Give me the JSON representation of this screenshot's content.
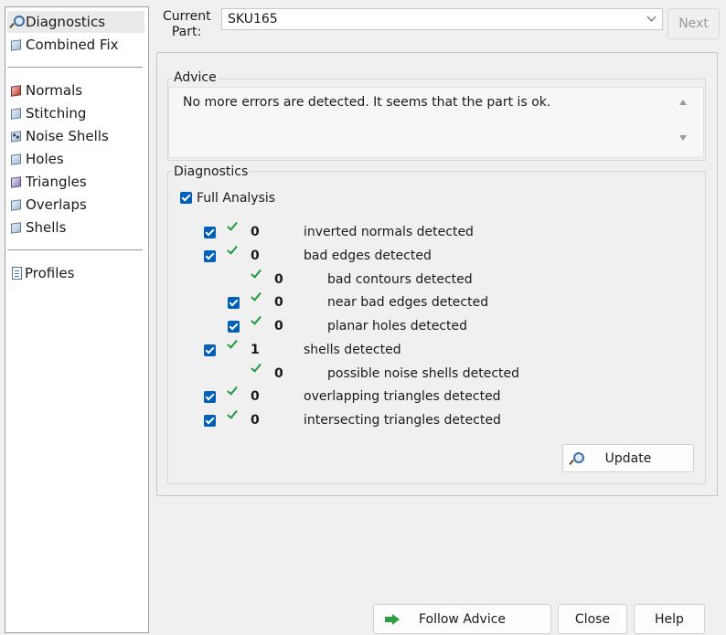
{
  "sidebar": {
    "items": [
      {
        "label": "Diagnostics",
        "icon": "search-icon"
      },
      {
        "label": "Combined Fix",
        "icon": "cube-icon"
      },
      {
        "label": "Normals",
        "icon": "cube-red-icon"
      },
      {
        "label": "Stitching",
        "icon": "cube-icon"
      },
      {
        "label": "Noise Shells",
        "icon": "cube-dots-icon"
      },
      {
        "label": "Holes",
        "icon": "cube-icon"
      },
      {
        "label": "Triangles",
        "icon": "cube-violet-icon"
      },
      {
        "label": "Overlaps",
        "icon": "cube-icon"
      },
      {
        "label": "Shells",
        "icon": "cube-icon"
      },
      {
        "label": "Profiles",
        "icon": "document-icon"
      }
    ]
  },
  "header": {
    "current_part_label": "Current Part:",
    "part_value": "SKU165",
    "next_label": "Next"
  },
  "advice": {
    "title": "Advice",
    "text": "No more errors are detected. It seems that the part is ok."
  },
  "diagnostics": {
    "title": "Diagnostics",
    "full_analysis_label": "Full Analysis",
    "rows": [
      {
        "count": "0",
        "label": "inverted normals detected",
        "checkbox": true
      },
      {
        "count": "0",
        "label": "bad edges detected",
        "checkbox": true
      },
      {
        "count": "0",
        "label": "bad contours detected",
        "checkbox": false
      },
      {
        "count": "0",
        "label": "near bad edges detected",
        "checkbox": true
      },
      {
        "count": "0",
        "label": "planar holes detected",
        "checkbox": true
      },
      {
        "count": "1",
        "label": "shells detected",
        "checkbox": true
      },
      {
        "count": "0",
        "label": "possible noise shells detected",
        "checkbox": false
      },
      {
        "count": "0",
        "label": "overlapping triangles detected",
        "checkbox": true
      },
      {
        "count": "0",
        "label": "intersecting triangles detected",
        "checkbox": true
      }
    ],
    "update_label": "Update"
  },
  "footer": {
    "follow_advice_label": "Follow Advice",
    "close_label": "Close",
    "help_label": "Help"
  },
  "colors": {
    "checkbox": "#005fb8",
    "tick": "#1f9b3c",
    "accent_arrow": "#2e9f3e"
  }
}
